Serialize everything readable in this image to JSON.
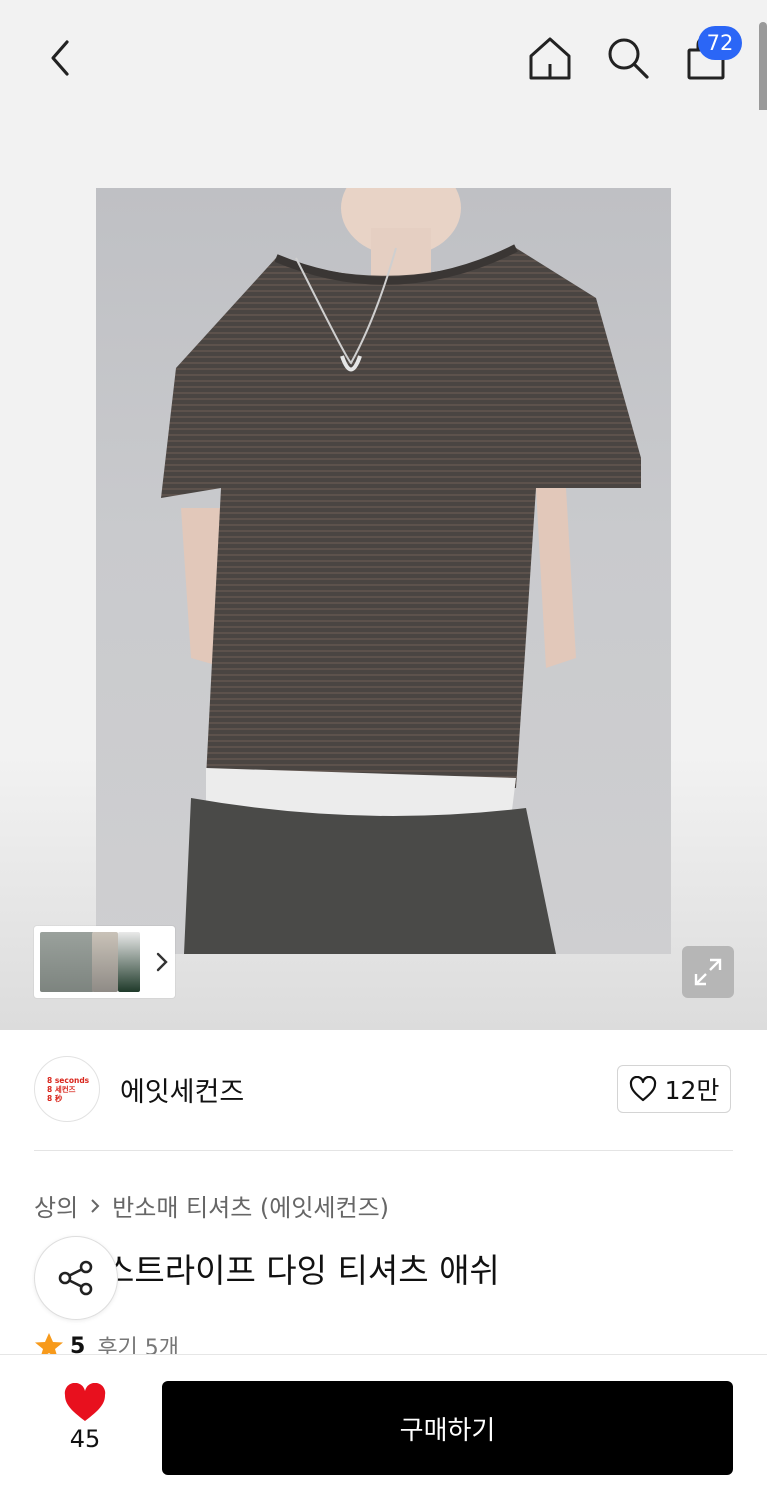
{
  "header": {
    "cart_count": "72",
    "icons": [
      "back-arrow-icon",
      "home-icon",
      "search-icon",
      "shopping-bag-icon"
    ]
  },
  "product_image": {
    "alt": "striped dyed t-shirt on model"
  },
  "brand": {
    "logo_lines": [
      "8 seconds",
      "8 세컨즈",
      "8 秒"
    ],
    "name": "에잇세컨즈",
    "likes": "12만"
  },
  "breadcrumb": {
    "category": "상의",
    "subcategory": "반소매 티셔츠 (에잇세컨즈)"
  },
  "product": {
    "title": "스트라이프 다잉 티셔츠 애쉬",
    "rating": "5",
    "reviews": "후기 5개"
  },
  "bottom": {
    "wish_count": "45",
    "buy_label": "구매하기"
  },
  "colors": {
    "accent_blue": "#2b66f6",
    "heart_red": "#e8101e",
    "star_orange": "#f79a1b",
    "brand_red": "#d9261c"
  }
}
